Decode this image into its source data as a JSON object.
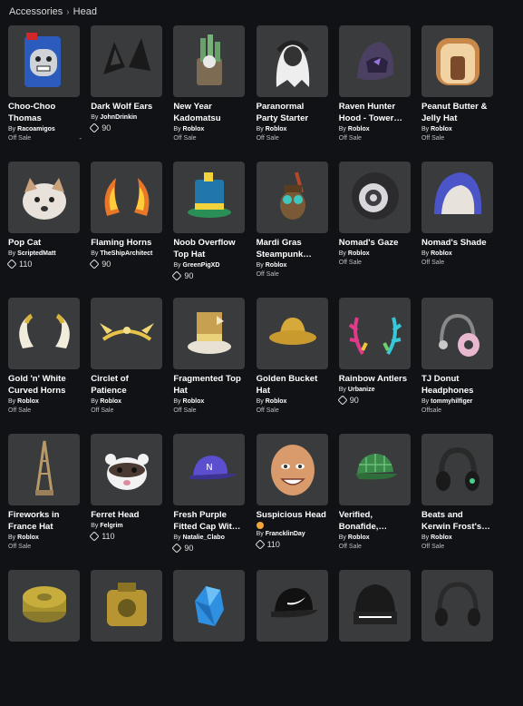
{
  "breadcrumb": {
    "parent": "Accessories",
    "separator": "›",
    "current": "Head"
  },
  "items": [
    {
      "name": "Choo-Choo Thomas",
      "by": "By",
      "creator": "Racoamigos",
      "price": "Off Sale",
      "robux": null,
      "extra": "-",
      "thumb": "train"
    },
    {
      "name": "Dark Wolf Ears",
      "by": "By",
      "creator": "JohnDrinkin",
      "price": null,
      "robux": "90",
      "thumb": "ears"
    },
    {
      "name": "New Year Kadomatsu",
      "by": "By",
      "creator": "Roblox",
      "price": "Off Sale",
      "robux": null,
      "thumb": "kadomatsu"
    },
    {
      "name": "Paranormal Party Starter",
      "by": "By",
      "creator": "Roblox",
      "price": "Off Sale",
      "robux": null,
      "thumb": "ghost"
    },
    {
      "name": "Raven Hunter Hood - Tower…",
      "by": "By",
      "creator": "Roblox",
      "price": "Off Sale",
      "robux": null,
      "thumb": "hood"
    },
    {
      "name": "Peanut Butter & Jelly Hat",
      "by": "By",
      "creator": "Roblox",
      "price": "Off Sale",
      "robux": null,
      "thumb": "bread"
    },
    {
      "name": "Pop Cat",
      "by": "By",
      "creator": "ScriptedMatt",
      "price": null,
      "robux": "110",
      "thumb": "cat"
    },
    {
      "name": "Flaming Horns",
      "by": "By",
      "creator": "TheShipArchitect",
      "price": null,
      "robux": "90",
      "thumb": "horns"
    },
    {
      "name": "Noob Overflow Top Hat",
      "by": "By",
      "creator": "GreenPigXD",
      "price": null,
      "robux": "90",
      "thumb": "tophat"
    },
    {
      "name": "Mardi Gras Steampunk…",
      "by": "By",
      "creator": "Roblox",
      "price": "Off Sale",
      "robux": null,
      "thumb": "steampunk"
    },
    {
      "name": "Nomad's Gaze",
      "by": "By",
      "creator": "Roblox",
      "price": "Off Sale",
      "robux": null,
      "thumb": "gaze"
    },
    {
      "name": "Nomad's Shade",
      "by": "By",
      "creator": "Roblox",
      "price": "Off Sale",
      "robux": null,
      "thumb": "shade"
    },
    {
      "name": "Gold 'n' White Curved Horns",
      "by": "By",
      "creator": "Roblox",
      "price": "Off Sale",
      "robux": null,
      "thumb": "curvedhorns"
    },
    {
      "name": "Circlet of Patience",
      "by": "By",
      "creator": "Roblox",
      "price": "Off Sale",
      "robux": null,
      "thumb": "circlet"
    },
    {
      "name": "Fragmented Top Hat",
      "by": "By",
      "creator": "Roblox",
      "price": "Off Sale",
      "robux": null,
      "thumb": "fraghat"
    },
    {
      "name": "Golden Bucket Hat",
      "by": "By",
      "creator": "Roblox",
      "price": "Off Sale",
      "robux": null,
      "thumb": "bucket"
    },
    {
      "name": "Rainbow Antlers",
      "by": "By",
      "creator": "Urbanize",
      "price": null,
      "robux": "90",
      "thumb": "antlers"
    },
    {
      "name": "TJ Donut Headphones",
      "by": "By",
      "creator": "tommyhilfiger",
      "price": "Offsale",
      "robux": null,
      "thumb": "donut"
    },
    {
      "name": "Fireworks in France Hat",
      "by": "By",
      "creator": "Roblox",
      "price": "Off Sale",
      "robux": null,
      "thumb": "eiffel"
    },
    {
      "name": "Ferret Head",
      "by": "By",
      "creator": "Felgrim",
      "price": null,
      "robux": "110",
      "thumb": "ferret"
    },
    {
      "name": "Fresh Purple Fitted Cap Wit…",
      "by": "By",
      "creator": "Natalie_Clabo",
      "price": null,
      "robux": "90",
      "thumb": "cap"
    },
    {
      "name": "Suspicious Head",
      "by": "",
      "creator": "",
      "price": null,
      "robux": null,
      "badge": true,
      "by2": "By",
      "creator2": "FrancklinDay",
      "robux2": "110",
      "thumb": "face"
    },
    {
      "name": "Verified, Bonafide,…",
      "by": "By",
      "creator": "Roblox",
      "price": "Off Sale",
      "robux": null,
      "thumb": "plaidcap"
    },
    {
      "name": "Beats and Kerwin Frost's…",
      "by": "By",
      "creator": "Roblox",
      "price": "Off Sale",
      "robux": null,
      "thumb": "beats"
    },
    {
      "name": "",
      "by": "",
      "creator": "",
      "price": null,
      "robux": null,
      "thumb": "puck"
    },
    {
      "name": "",
      "by": "",
      "creator": "",
      "price": null,
      "robux": null,
      "thumb": "tape"
    },
    {
      "name": "",
      "by": "",
      "creator": "",
      "price": null,
      "robux": null,
      "thumb": "crystal"
    },
    {
      "name": "",
      "by": "",
      "creator": "",
      "price": null,
      "robux": null,
      "thumb": "nikecap"
    },
    {
      "name": "",
      "by": "",
      "creator": "",
      "price": null,
      "robux": null,
      "thumb": "beanie"
    },
    {
      "name": "",
      "by": "",
      "creator": "",
      "price": null,
      "robux": null,
      "thumb": "headset"
    }
  ]
}
